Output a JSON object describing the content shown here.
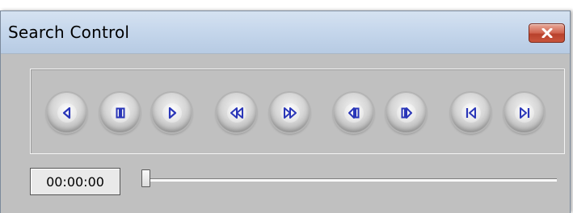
{
  "window": {
    "title": "Search Control",
    "close_label": "Close"
  },
  "controls": {
    "buttons": [
      {
        "name": "play-backward-button",
        "icon": "play-backward-icon"
      },
      {
        "name": "pause-button",
        "icon": "pause-icon"
      },
      {
        "name": "play-button",
        "icon": "play-icon"
      },
      {
        "name": "fast-rewind-button",
        "icon": "fast-rewind-icon"
      },
      {
        "name": "fast-forward-button",
        "icon": "fast-forward-icon"
      },
      {
        "name": "step-backward-button",
        "icon": "step-backward-icon"
      },
      {
        "name": "step-forward-button",
        "icon": "step-forward-icon"
      },
      {
        "name": "skip-to-start-button",
        "icon": "skip-to-start-icon"
      },
      {
        "name": "skip-to-end-button",
        "icon": "skip-to-end-icon"
      }
    ],
    "glyph_color": "#2a36b8"
  },
  "timeline": {
    "time": "00:00:00",
    "position": 0
  },
  "colors": {
    "background": "#c0c0c0",
    "titlebar": "#c6d7ec",
    "close_button": "#c9553d"
  }
}
